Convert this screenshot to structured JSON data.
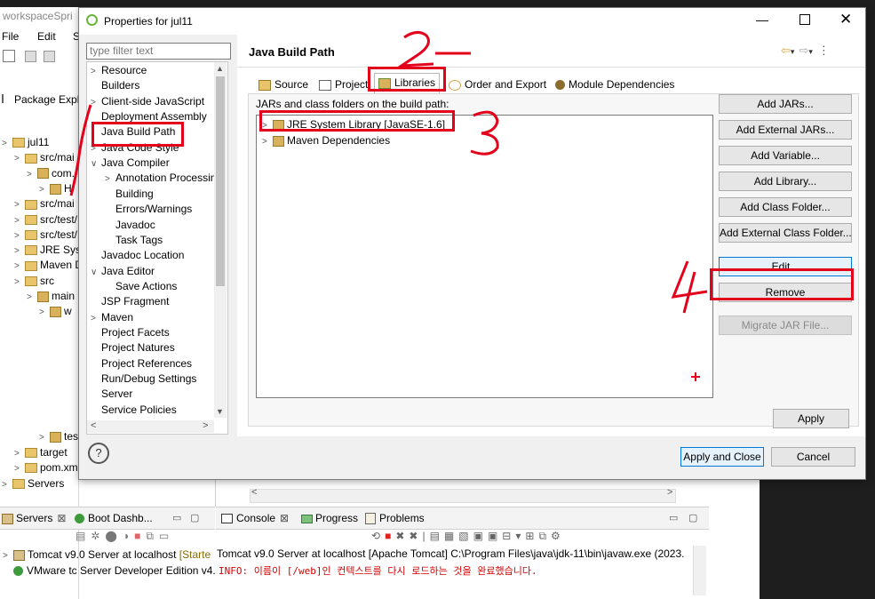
{
  "workspace": {
    "title": "workspaceSpri",
    "menu": [
      "File",
      "Edit",
      "Sour"
    ],
    "explorer_title": "Package Explo",
    "tree": [
      {
        "label": "jul11",
        "indent": 0
      },
      {
        "label": "src/mai",
        "indent": 1
      },
      {
        "label": "com.",
        "indent": 2
      },
      {
        "label": "H",
        "indent": 3
      },
      {
        "label": "src/mai",
        "indent": 1
      },
      {
        "label": "src/test/",
        "indent": 1
      },
      {
        "label": "src/test/",
        "indent": 1
      },
      {
        "label": "JRE Syst",
        "indent": 1
      },
      {
        "label": "Maven D",
        "indent": 1
      },
      {
        "label": "src",
        "indent": 1
      },
      {
        "label": "main",
        "indent": 2
      },
      {
        "label": "w",
        "indent": 3
      }
    ],
    "tree_lower": [
      {
        "label": "test",
        "indent": 3
      },
      {
        "label": "target",
        "indent": 1
      },
      {
        "label": "pom.xm",
        "indent": 1
      },
      {
        "label": "Servers",
        "indent": 0
      }
    ]
  },
  "bottom": {
    "servers_tab": "Servers",
    "boot_tab": "Boot Dashb...",
    "console_tab": "Console",
    "progress_tab": "Progress",
    "problems_tab": "Problems",
    "server_items": [
      "Tomcat v9.0 Server at localhost",
      "VMware tc Server Developer Edition v4."
    ],
    "server_state": "[Starte",
    "console_header": "Tomcat v9.0 Server at localhost [Apache Tomcat] C:\\Program Files\\java\\jdk-11\\bin\\javaw.exe  (2023.",
    "console_line": "INFO: 이름이 [/web]인 컨텍스트를 다시 로드하는 것을 완료했습니다."
  },
  "dialog": {
    "title": "Properties for jul11",
    "filter_placeholder": "type filter text",
    "nav": [
      {
        "label": "Resource",
        "indent": 0,
        "chevron": true
      },
      {
        "label": "Builders",
        "indent": 0,
        "chevron": false
      },
      {
        "label": "Client-side JavaScript",
        "indent": 0,
        "chevron": true
      },
      {
        "label": "Deployment Assembly",
        "indent": 0,
        "chevron": false
      },
      {
        "label": "Java Build Path",
        "indent": 0,
        "chevron": false
      },
      {
        "label": "Java Code Style",
        "indent": 0,
        "chevron": true
      },
      {
        "label": "Java Compiler",
        "indent": 0,
        "chevron": true,
        "open": true
      },
      {
        "label": "Annotation Processin",
        "indent": 1,
        "chevron": true
      },
      {
        "label": "Building",
        "indent": 1,
        "chevron": false
      },
      {
        "label": "Errors/Warnings",
        "indent": 1,
        "chevron": false
      },
      {
        "label": "Javadoc",
        "indent": 1,
        "chevron": false
      },
      {
        "label": "Task Tags",
        "indent": 1,
        "chevron": false
      },
      {
        "label": "Javadoc Location",
        "indent": 0,
        "chevron": false
      },
      {
        "label": "Java Editor",
        "indent": 0,
        "chevron": true,
        "open": true
      },
      {
        "label": "Save Actions",
        "indent": 1,
        "chevron": false
      },
      {
        "label": "JSP Fragment",
        "indent": 0,
        "chevron": false
      },
      {
        "label": "Maven",
        "indent": 0,
        "chevron": true
      },
      {
        "label": "Project Facets",
        "indent": 0,
        "chevron": false
      },
      {
        "label": "Project Natures",
        "indent": 0,
        "chevron": false
      },
      {
        "label": "Project References",
        "indent": 0,
        "chevron": false
      },
      {
        "label": "Run/Debug Settings",
        "indent": 0,
        "chevron": false
      },
      {
        "label": "Server",
        "indent": 0,
        "chevron": false
      },
      {
        "label": "Service Policies",
        "indent": 0,
        "chevron": false
      }
    ],
    "page_title": "Java Build Path",
    "tabs": [
      "Source",
      "Project",
      "Libraries",
      "Order and Export",
      "Module Dependencies"
    ],
    "jars_label": "JARs and class folders on the build path:",
    "libraries": [
      "JRE System Library [JavaSE-1.6]",
      "Maven Dependencies"
    ],
    "buttons": [
      "Add JARs...",
      "Add External JARs...",
      "Add Variable...",
      "Add Library...",
      "Add Class Folder...",
      "Add External Class Folder...",
      "Edit...",
      "Remove",
      "Migrate JAR File..."
    ],
    "apply": "Apply",
    "apply_close": "Apply and Close",
    "cancel": "Cancel",
    "help": "?"
  },
  "annotations": {
    "numbers": [
      "2",
      "3",
      "4"
    ],
    "color": "#e3001a"
  }
}
